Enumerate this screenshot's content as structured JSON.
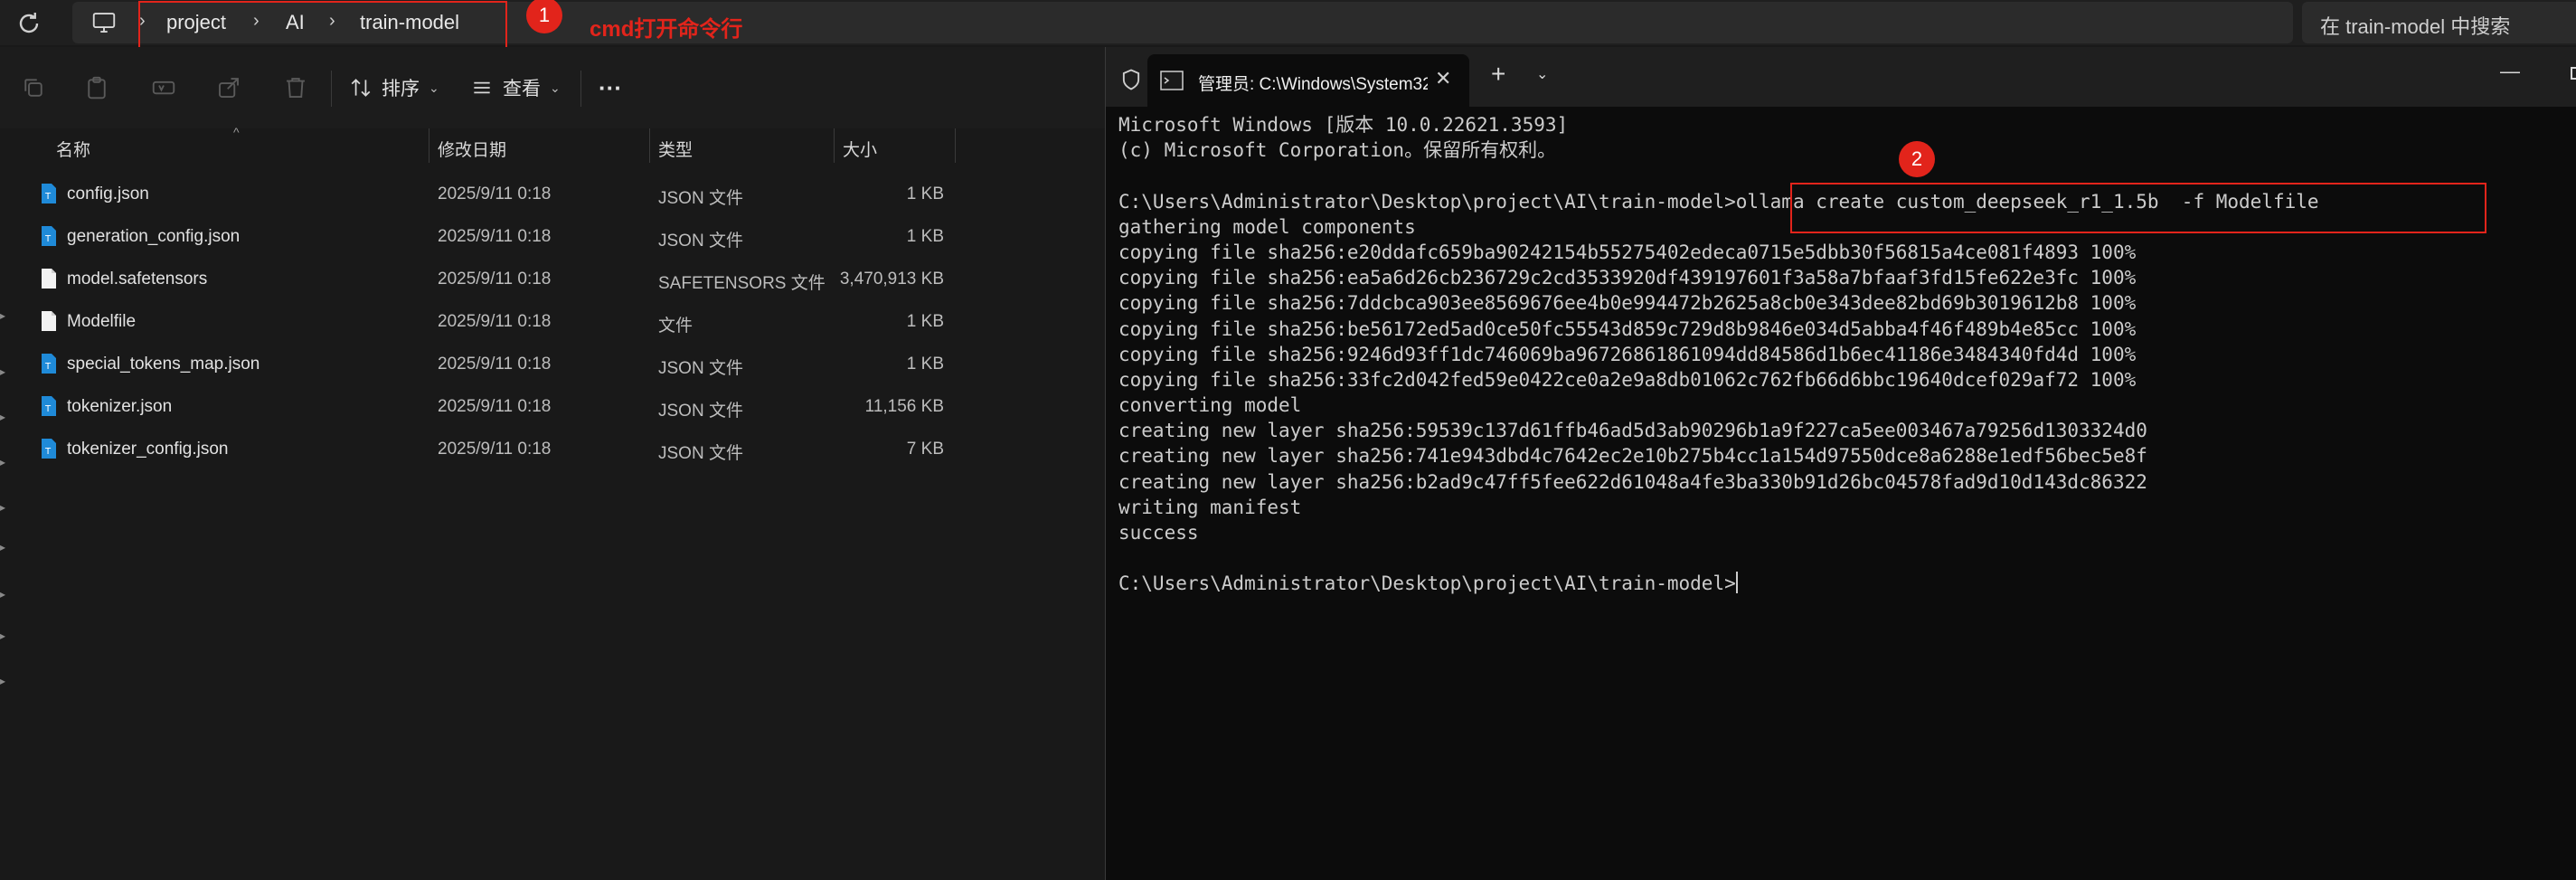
{
  "explorer": {
    "breadcrumb": [
      "project",
      "AI",
      "train-model"
    ],
    "search_placeholder": "在 train-model 中搜索",
    "toolbar": {
      "sort_label": "排序",
      "view_label": "查看",
      "more_label": "···"
    },
    "columns": {
      "name": "名称",
      "modified": "修改日期",
      "type": "类型",
      "size": "大小"
    },
    "files": [
      {
        "name": "config.json",
        "modified": "2025/9/11 0:18",
        "type": "JSON 文件",
        "size": "1 KB",
        "icon": "json-file-icon"
      },
      {
        "name": "generation_config.json",
        "modified": "2025/9/11 0:18",
        "type": "JSON 文件",
        "size": "1 KB",
        "icon": "json-file-icon"
      },
      {
        "name": "model.safetensors",
        "modified": "2025/9/11 0:18",
        "type": "SAFETENSORS 文件",
        "size": "3,470,913 KB",
        "icon": "file-icon"
      },
      {
        "name": "Modelfile",
        "modified": "2025/9/11 0:18",
        "type": "文件",
        "size": "1 KB",
        "icon": "file-icon"
      },
      {
        "name": "special_tokens_map.json",
        "modified": "2025/9/11 0:18",
        "type": "JSON 文件",
        "size": "1 KB",
        "icon": "json-file-icon"
      },
      {
        "name": "tokenizer.json",
        "modified": "2025/9/11 0:18",
        "type": "JSON 文件",
        "size": "11,156 KB",
        "icon": "json-file-icon"
      },
      {
        "name": "tokenizer_config.json",
        "modified": "2025/9/11 0:18",
        "type": "JSON 文件",
        "size": "7 KB",
        "icon": "json-file-icon"
      }
    ]
  },
  "annotations": {
    "step1_number": "1",
    "step1_text": "cmd打开命令行",
    "step2_number": "2"
  },
  "terminal": {
    "tab_title": "管理员: C:\\Windows\\System32",
    "new_tab_label": "+",
    "lines": [
      "Microsoft Windows [版本 10.0.22621.3593]",
      "(c) Microsoft Corporation。保留所有权利。",
      "",
      "C:\\Users\\Administrator\\Desktop\\project\\AI\\train-model>ollama create custom_deepseek_r1_1.5b  -f Modelfile",
      "gathering model components",
      "copying file sha256:e20ddafc659ba90242154b55275402edeca0715e5dbb30f56815a4ce081f4893 100%",
      "copying file sha256:ea5a6d26cb236729c2cd3533920df439197601f3a58a7bfaaf3fd15fe622e3fc 100%",
      "copying file sha256:7ddcbca903ee8569676ee4b0e994472b2625a8cb0e343dee82bd69b3019612b8 100%",
      "copying file sha256:be56172ed5ad0ce50fc55543d859c729d8b9846e034d5abba4f46f489b4e85cc 100%",
      "copying file sha256:9246d93ff1dc746069ba96726861861094dd84586d1b6ec41186e3484340fd4d 100%",
      "copying file sha256:33fc2d042fed59e0422ce0a2e9a8db01062c762fb66d6bbc19640dcef029af72 100%",
      "converting model",
      "creating new layer sha256:59539c137d61ffb46ad5d3ab90296b1a9f227ca5ee003467a79256d1303324d0",
      "creating new layer sha256:741e943dbd4c7642ec2e10b275b4cc1a154d97550dce8a6288e1edf56bec5e8f",
      "creating new layer sha256:b2ad9c47ff5fee622d61048a4fe3ba330b91d26bc04578fad9d10d143dc86322",
      "writing manifest",
      "success",
      "",
      "C:\\Users\\Administrator\\Desktop\\project\\AI\\train-model>"
    ]
  }
}
